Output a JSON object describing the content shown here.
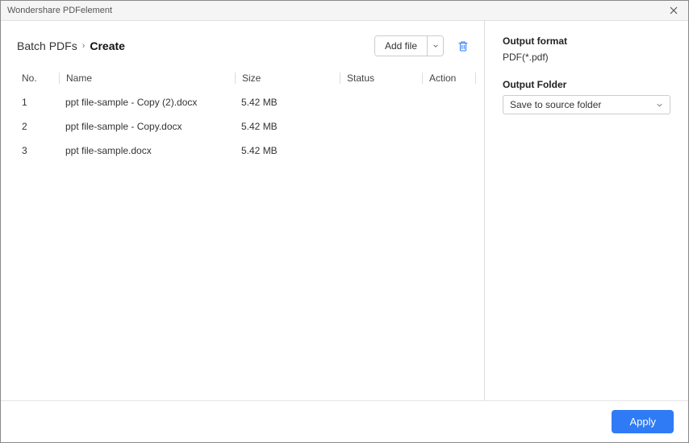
{
  "window_title": "Wondershare PDFelement",
  "breadcrumb": {
    "root": "Batch PDFs",
    "current": "Create"
  },
  "toolbar": {
    "add_file_label": "Add file"
  },
  "table": {
    "headers": {
      "no": "No.",
      "name": "Name",
      "size": "Size",
      "status": "Status",
      "action": "Action"
    },
    "rows": [
      {
        "no": "1",
        "name": "ppt file-sample - Copy (2).docx",
        "size": "5.42 MB",
        "status": "",
        "action": ""
      },
      {
        "no": "2",
        "name": "ppt file-sample - Copy.docx",
        "size": "5.42 MB",
        "status": "",
        "action": ""
      },
      {
        "no": "3",
        "name": "ppt file-sample.docx",
        "size": "5.42 MB",
        "status": "",
        "action": ""
      }
    ]
  },
  "side": {
    "output_format_label": "Output format",
    "output_format_value": "PDF(*.pdf)",
    "output_folder_label": "Output Folder",
    "output_folder_value": "Save to source folder"
  },
  "footer": {
    "apply_label": "Apply"
  }
}
